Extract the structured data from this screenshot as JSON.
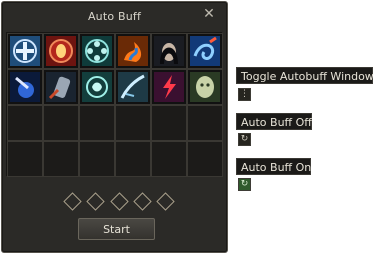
{
  "window": {
    "title": "Auto Buff",
    "close_glyph": "✕"
  },
  "buff_slots": {
    "row1": [
      "cross-rune-icon",
      "eye-shield-icon",
      "wheel-rune-icon",
      "fire-swirl-icon",
      "dark-woman-portrait-icon",
      "blue-whirl-icon"
    ],
    "row2": [
      "blue-magic-icon",
      "gauntlet-icon",
      "cyan-rune-icon",
      "frost-icon",
      "red-lightning-icon",
      "ghost-face-icon"
    ]
  },
  "start_label": "Start",
  "legend": {
    "toggle_label": "Toggle Autobuff Window",
    "off_label": "Auto Buff Off",
    "on_label": "Auto Buff On"
  },
  "colors": {
    "panel_bg": "#2b2a27",
    "on_icon": "#2f5a2c"
  }
}
